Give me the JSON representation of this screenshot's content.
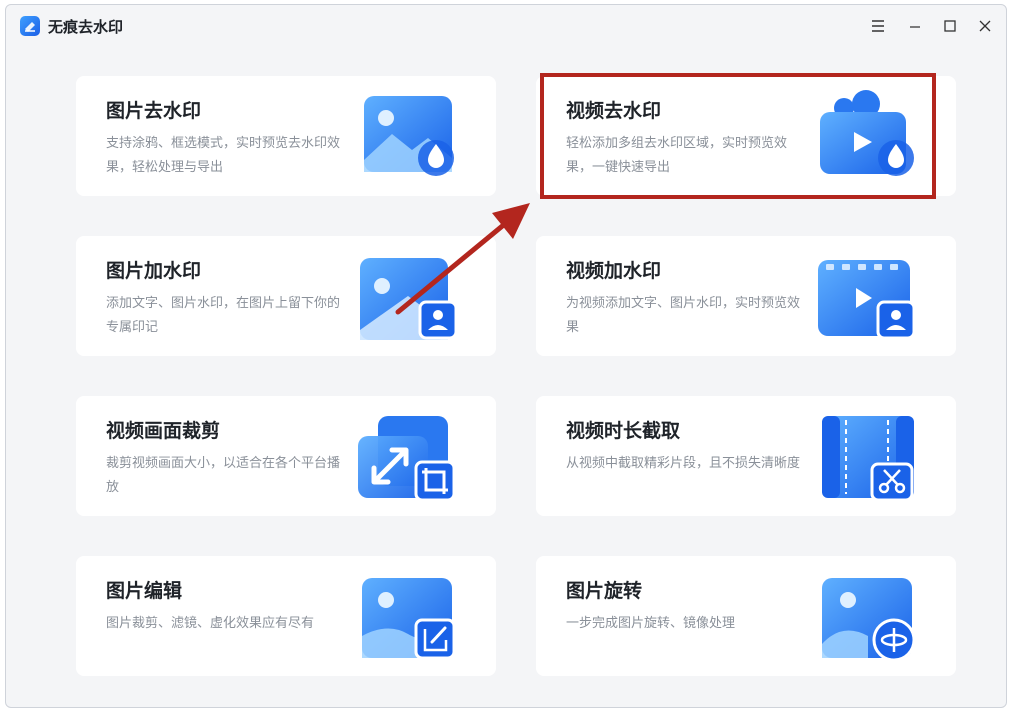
{
  "app": {
    "title": "无痕去水印"
  },
  "window_controls": {
    "menu": "menu-icon",
    "minimize": "minimize-icon",
    "maximize": "maximize-icon",
    "close": "close-icon"
  },
  "colors": {
    "accent": "#1c5fe6",
    "highlight": "#b3261e",
    "card_bg": "#ffffff",
    "window_bg": "#f4f5f7"
  },
  "cards": [
    {
      "title": "图片去水印",
      "desc": "支持涂鸦、框选模式，实时预览去水印效果，轻松处理与导出",
      "icon": "image-remove-watermark-icon"
    },
    {
      "title": "视频去水印",
      "desc": "轻松添加多组去水印区域，实时预览效果，一键快速导出",
      "icon": "video-remove-watermark-icon"
    },
    {
      "title": "图片加水印",
      "desc": "添加文字、图片水印，在图片上留下你的专属印记",
      "icon": "image-add-watermark-icon"
    },
    {
      "title": "视频加水印",
      "desc": "为视频添加文字、图片水印，实时预览效果",
      "icon": "video-add-watermark-icon"
    },
    {
      "title": "视频画面裁剪",
      "desc": "裁剪视频画面大小，以适合在各个平台播放",
      "icon": "video-crop-icon"
    },
    {
      "title": "视频时长截取",
      "desc": "从视频中截取精彩片段，且不损失清晰度",
      "icon": "video-trim-icon"
    },
    {
      "title": "图片编辑",
      "desc": "图片裁剪、滤镜、虚化效果应有尽有",
      "icon": "image-edit-icon"
    },
    {
      "title": "图片旋转",
      "desc": "一步完成图片旋转、镜像处理",
      "icon": "image-rotate-icon"
    }
  ]
}
